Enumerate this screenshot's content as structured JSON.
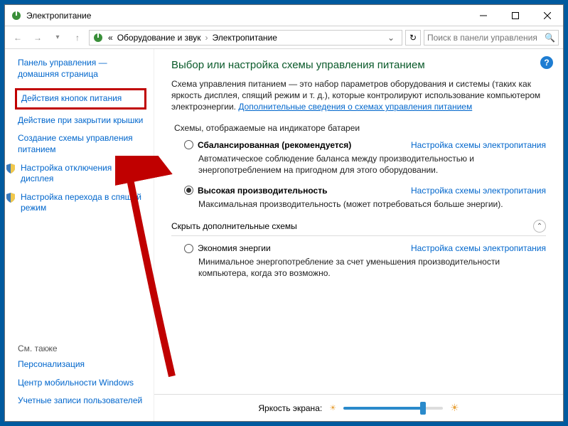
{
  "titlebar": {
    "title": "Электропитание"
  },
  "breadcrumb": {
    "prefix": "«",
    "item1": "Оборудование и звук",
    "item2": "Электропитание"
  },
  "search": {
    "placeholder": "Поиск в панели управления"
  },
  "sidebar": {
    "home": "Панель управления — домашняя страница",
    "links": [
      "Действия кнопок питания",
      "Действие при закрытии крышки",
      "Создание схемы управления питанием",
      "Настройка отключения дисплея",
      "Настройка перехода в спящий режим"
    ],
    "see_also_heading": "См. также",
    "see_also": [
      "Персонализация",
      "Центр мобильности Windows",
      "Учетные записи пользователей"
    ]
  },
  "main": {
    "heading": "Выбор или настройка схемы управления питанием",
    "description": "Схема управления питанием — это набор параметров оборудования и системы (таких как яркость дисплея, спящий режим и т. д.), которые контролируют использование компьютером электроэнергии. ",
    "desc_link": "Дополнительные сведения о схемах управления питанием",
    "section1": "Схемы, отображаемые на индикаторе батареи",
    "plan1": {
      "name": "Сбалансированная (рекомендуется)",
      "link": "Настройка схемы электропитания",
      "desc": "Автоматическое соблюдение баланса между производительностью и энергопотреблением на пригодном для этого оборудовании."
    },
    "plan2": {
      "name": "Высокая производительность",
      "link": "Настройка схемы электропитания",
      "desc": "Максимальная производительность (может потребоваться больше энергии)."
    },
    "section2": "Скрыть дополнительные схемы",
    "plan3": {
      "name": "Экономия энергии",
      "link": "Настройка схемы электропитания",
      "desc": "Минимальное энергопотребление за счет уменьшения производительности компьютера, когда это возможно."
    },
    "brightness_label": "Яркость экрана:"
  }
}
